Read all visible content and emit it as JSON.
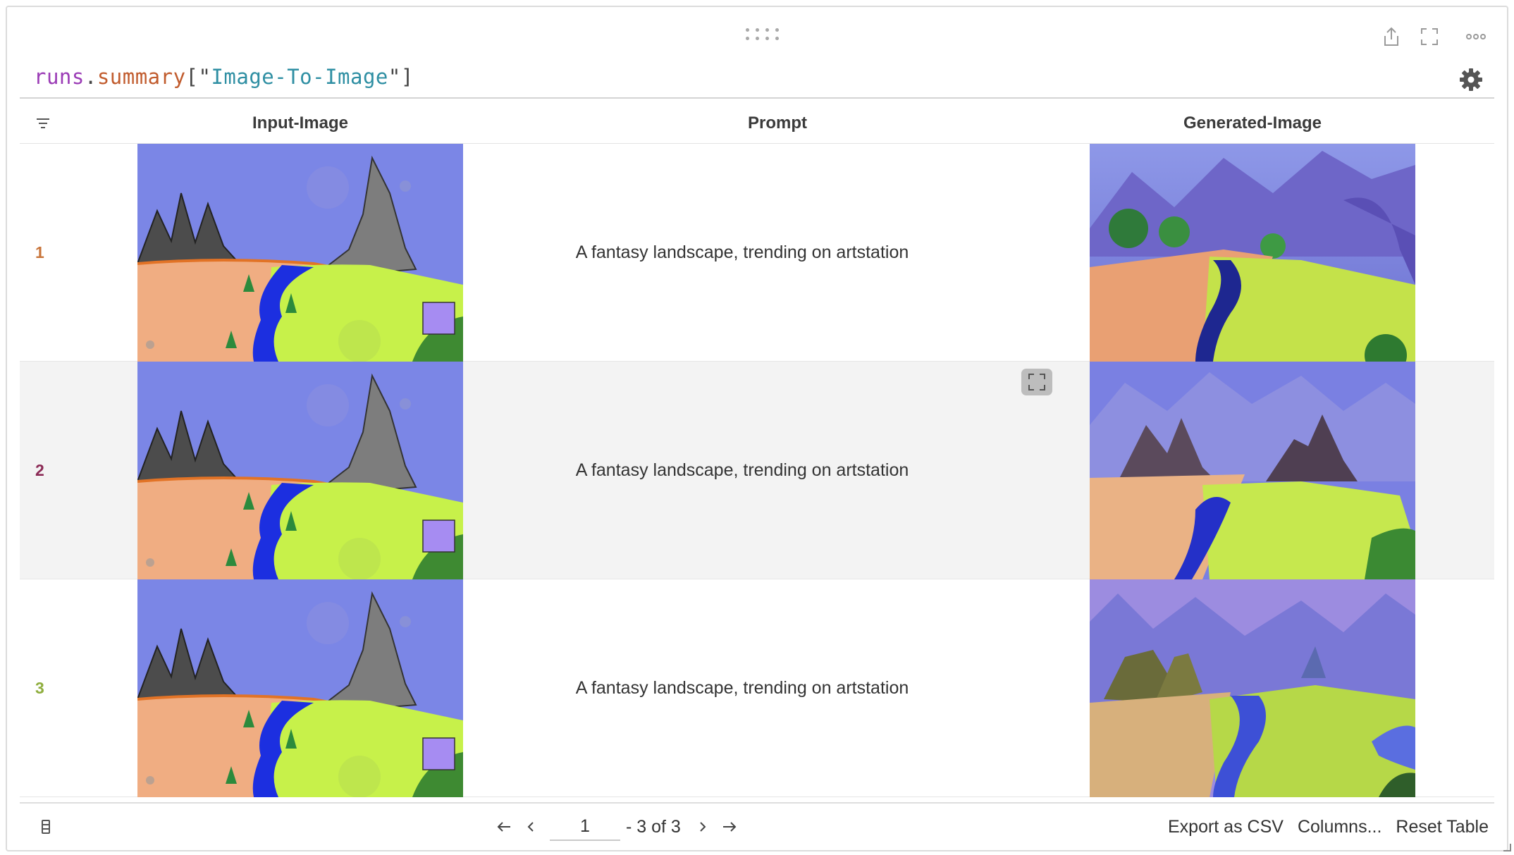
{
  "panel": {
    "expression": {
      "var": "runs",
      "dot": ".",
      "attr": "summary",
      "open": "[\"",
      "key": "Image-To-Image",
      "close": "\"]"
    }
  },
  "table": {
    "columns": [
      "Input-Image",
      "Prompt",
      "Generated-Image"
    ],
    "rows": [
      {
        "index": "1",
        "index_color": "#c8743a",
        "prompt": "A fantasy landscape, trending on artstation"
      },
      {
        "index": "2",
        "index_color": "#8b2a55",
        "prompt": "A fantasy landscape, trending on artstation"
      },
      {
        "index": "3",
        "index_color": "#8fae3e",
        "prompt": "A fantasy landscape, trending on artstation"
      }
    ]
  },
  "pagination": {
    "page": "1",
    "range_text": "- 3 of 3"
  },
  "actions": {
    "export": "Export as CSV",
    "columns": "Columns...",
    "reset": "Reset Table"
  },
  "icons": [
    "drag-handle-icon",
    "share-icon",
    "fullscreen-icon",
    "more-icon",
    "gear-icon",
    "filter-icon",
    "expand-icon",
    "columns-icon",
    "first-page-icon",
    "prev-page-icon",
    "next-page-icon",
    "last-page-icon",
    "resize-handle-icon"
  ]
}
